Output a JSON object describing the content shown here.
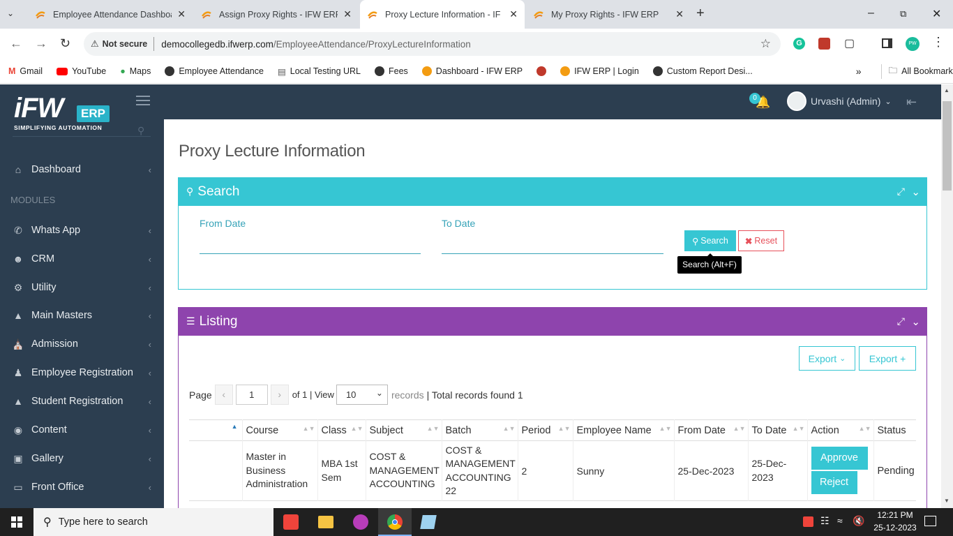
{
  "browser": {
    "tabs": [
      {
        "title": "Employee Attendance Dashboa",
        "active": false
      },
      {
        "title": "Assign Proxy Rights - IFW ERP",
        "active": false
      },
      {
        "title": "Proxy Lecture Information - IFW",
        "active": true
      },
      {
        "title": "My Proxy Rights - IFW ERP",
        "active": false
      }
    ],
    "security_label": "Not secure",
    "url_host": "democollegedb.ifwerp.com",
    "url_path": "/EmployeeAttendance/ProxyLectureInformation",
    "bookmarks": [
      "Gmail",
      "YouTube",
      "Maps",
      "Employee Attendance",
      "Local Testing URL",
      "Fees",
      "Dashboard - IFW ERP",
      "IFW ERP | Login",
      "Custom Report Desi..."
    ],
    "all_bookmarks": "All Bookmarks"
  },
  "app": {
    "logo_text": "iFW",
    "logo_erp": "ERP",
    "logo_tagline": "SIMPLIFYING AUTOMATION",
    "notifications_count": "0",
    "user_name": "Urvashi (Admin)",
    "sidebar": {
      "dashboard": "Dashboard",
      "section_label": "MODULES",
      "items": [
        "Whats App",
        "CRM",
        "Utility",
        "Main Masters",
        "Admission",
        "Employee Registration",
        "Student Registration",
        "Content",
        "Gallery",
        "Front Office"
      ]
    },
    "page_title": "Proxy Lecture Information",
    "search_panel": {
      "title": "Search",
      "from_date_label": "From Date",
      "to_date_label": "To Date",
      "search_button": "Search",
      "reset_button": "Reset",
      "tooltip": "Search (Alt+F)"
    },
    "listing_panel": {
      "title": "Listing",
      "export_button": "Export",
      "export_plus_button": "Export +",
      "page_label": "Page",
      "page_value": "1",
      "of_text": "of 1 | View",
      "page_size": "10",
      "records_text": "records",
      "total_text": "| Total records found 1",
      "columns": [
        "",
        "Course",
        "Class",
        "Subject",
        "Batch",
        "Period",
        "Employee Name",
        "From Date",
        "To Date",
        "Action",
        "Status"
      ],
      "rows": [
        {
          "course": "Master in Business Administration",
          "class": "MBA 1st Sem",
          "subject": "COST & MANAGEMENT ACCOUNTING",
          "batch": "COST & MANAGEMENT ACCOUNTING 22",
          "period": "2",
          "employee": "Sunny",
          "from_date": "25-Dec-2023",
          "to_date": "25-Dec-2023",
          "approve": "Approve",
          "reject": "Reject",
          "status": "Pending"
        }
      ]
    }
  },
  "taskbar": {
    "search_placeholder": "Type here to search",
    "time": "12:21 PM",
    "date": "25-12-2023"
  },
  "colors": {
    "sidebar_bg": "#2c3e50",
    "search_header": "#36c6d3",
    "listing_header": "#8e44ad",
    "button_teal": "#36c6d3",
    "reset_red": "#e7505a"
  }
}
